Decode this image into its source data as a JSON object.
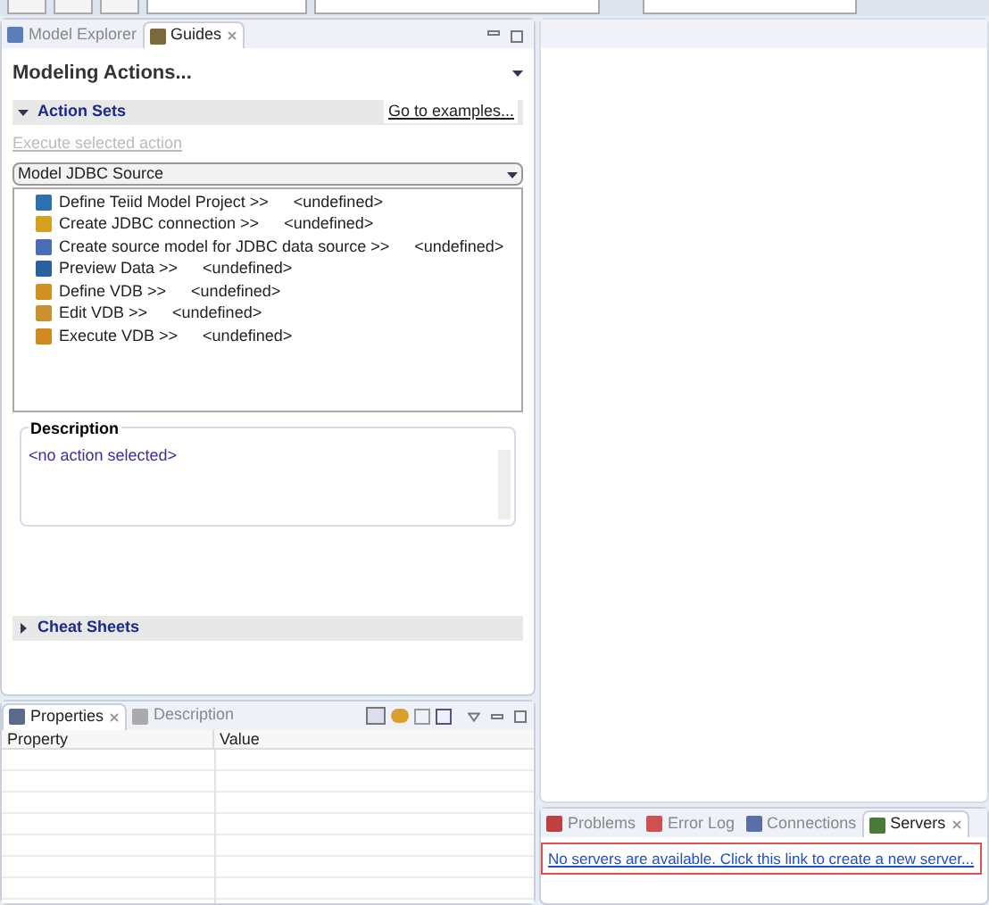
{
  "left_tabs": [
    {
      "label": "Model Explorer",
      "selected": false
    },
    {
      "label": "Guides",
      "selected": true
    }
  ],
  "guides": {
    "title": "Modeling Actions...",
    "action_sets": {
      "title": "Action Sets",
      "expanded": true,
      "examples_link": "Go to examples...",
      "execute_link": "Execute selected action",
      "execute_disabled": true,
      "dropdown": "Model JDBC Source",
      "actions": [
        {
          "label": "Define Teiid Model Project >>",
          "status": "<undefined>"
        },
        {
          "label": "Create JDBC connection >>",
          "status": "<undefined>"
        },
        {
          "label": "Create source model for JDBC data source >>",
          "status": "<undefined>"
        },
        {
          "label": "Preview Data >>",
          "status": "<undefined>"
        },
        {
          "label": "Define VDB >>",
          "status": "<undefined>"
        },
        {
          "label": "Edit VDB >>",
          "status": "<undefined>"
        },
        {
          "label": "Execute VDB >>",
          "status": "<undefined>"
        }
      ]
    },
    "description": {
      "title": "Description",
      "text": "<no action selected>"
    },
    "cheat_sheets": {
      "title": "Cheat Sheets",
      "expanded": false
    }
  },
  "bottom_tabs": [
    {
      "label": "Properties",
      "selected": true
    },
    {
      "label": "Description",
      "selected": false
    }
  ],
  "properties_table": {
    "columns": [
      "Property",
      "Value"
    ]
  },
  "server_tabs": [
    {
      "label": "Problems",
      "selected": false
    },
    {
      "label": "Error Log",
      "selected": false
    },
    {
      "label": "Connections",
      "selected": false
    },
    {
      "label": "Servers",
      "selected": true
    }
  ],
  "servers_link": "No servers are available. Click this link to create a new server..."
}
